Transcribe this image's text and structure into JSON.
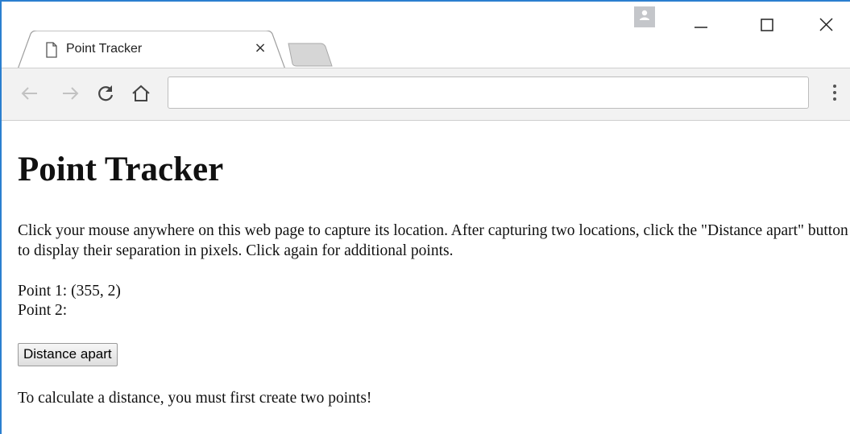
{
  "browser": {
    "tab_title": "Point Tracker",
    "tab_close_glyph": "×",
    "address_value": "",
    "icons": {
      "tab": "page-icon",
      "back": "arrow-left-icon",
      "forward": "arrow-right-icon",
      "reload": "reload-icon",
      "home": "home-icon",
      "menu": "more-vert-icon",
      "profile": "profile-icon",
      "minimize": "minimize-icon",
      "maximize": "maximize-icon",
      "close": "close-icon"
    },
    "colors": {
      "window_border": "#2b7fcf",
      "toolbar_bg": "#f2f2f2"
    }
  },
  "page": {
    "heading": "Point Tracker",
    "intro": "Click your mouse anywhere on this web page to capture its location. After capturing two locations, click the \"Distance apart\" button to display their separation in pixels. Click again for additional points.",
    "point1_label": "Point 1: (355, 2)",
    "point2_label": "Point 2:",
    "distance_button_label": "Distance apart",
    "message": "To calculate a distance, you must first create two points!"
  }
}
